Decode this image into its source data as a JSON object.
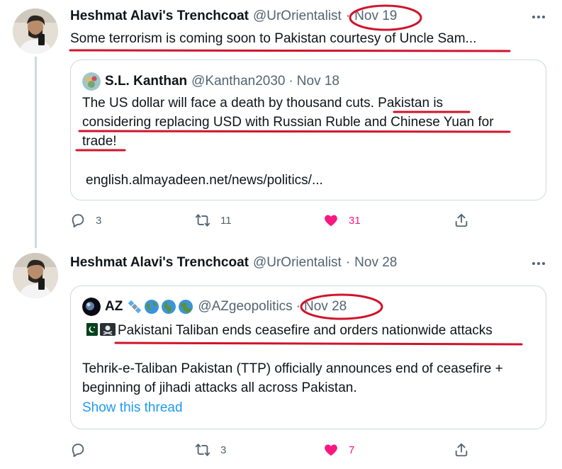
{
  "tweet1": {
    "author_name": "Heshmat Alavi's Trenchcoat",
    "author_handle": "@UrOrientalist",
    "separator": "·",
    "date": "Nov 19",
    "text": "Some terrorism is coming soon to Pakistan courtesy of Uncle Sam...",
    "quote": {
      "author_name": "S.L. Kanthan",
      "author_handle": "@Kanthan2030",
      "separator": "·",
      "date": "Nov 18",
      "text_line1": "The US dollar will face a death by thousand cuts. Pakistan is",
      "text_line2": "considering replacing USD with Russian Ruble and Chinese Yuan for",
      "text_line3": "trade!",
      "link": "english.almayadeen.net/news/politics/..."
    },
    "actions": {
      "reply_count": "3",
      "retweet_count": "11",
      "like_count": "31"
    }
  },
  "tweet2": {
    "author_name": "Heshmat Alavi's Trenchcoat",
    "author_handle": "@UrOrientalist",
    "separator": "·",
    "date": "Nov 28",
    "quote": {
      "author_name": "AZ",
      "author_handle": "@AZgeopolitics",
      "separator": "·",
      "date": "Nov 28",
      "headline": "Pakistani Taliban ends ceasefire and orders nationwide attacks",
      "body_line1": "Tehrik-e-Taliban Pakistan (TTP) officially announces end of ceasefire +",
      "body_line2": "beginning of jihadi attacks all across Pakistan.",
      "show_thread": "Show this thread"
    },
    "actions": {
      "reply_count": "",
      "retweet_count": "3",
      "like_count": "7"
    }
  },
  "icons": [
    "reply-icon",
    "retweet-icon",
    "like-icon",
    "share-icon",
    "more-icon",
    "satellite-icon",
    "globe-icon",
    "pakistan-flag-icon",
    "pirate-flag-icon"
  ],
  "colors": {
    "annotation": "#d0142c",
    "like": "#f91880",
    "link": "#1d9bf0",
    "secondary": "#536471"
  }
}
